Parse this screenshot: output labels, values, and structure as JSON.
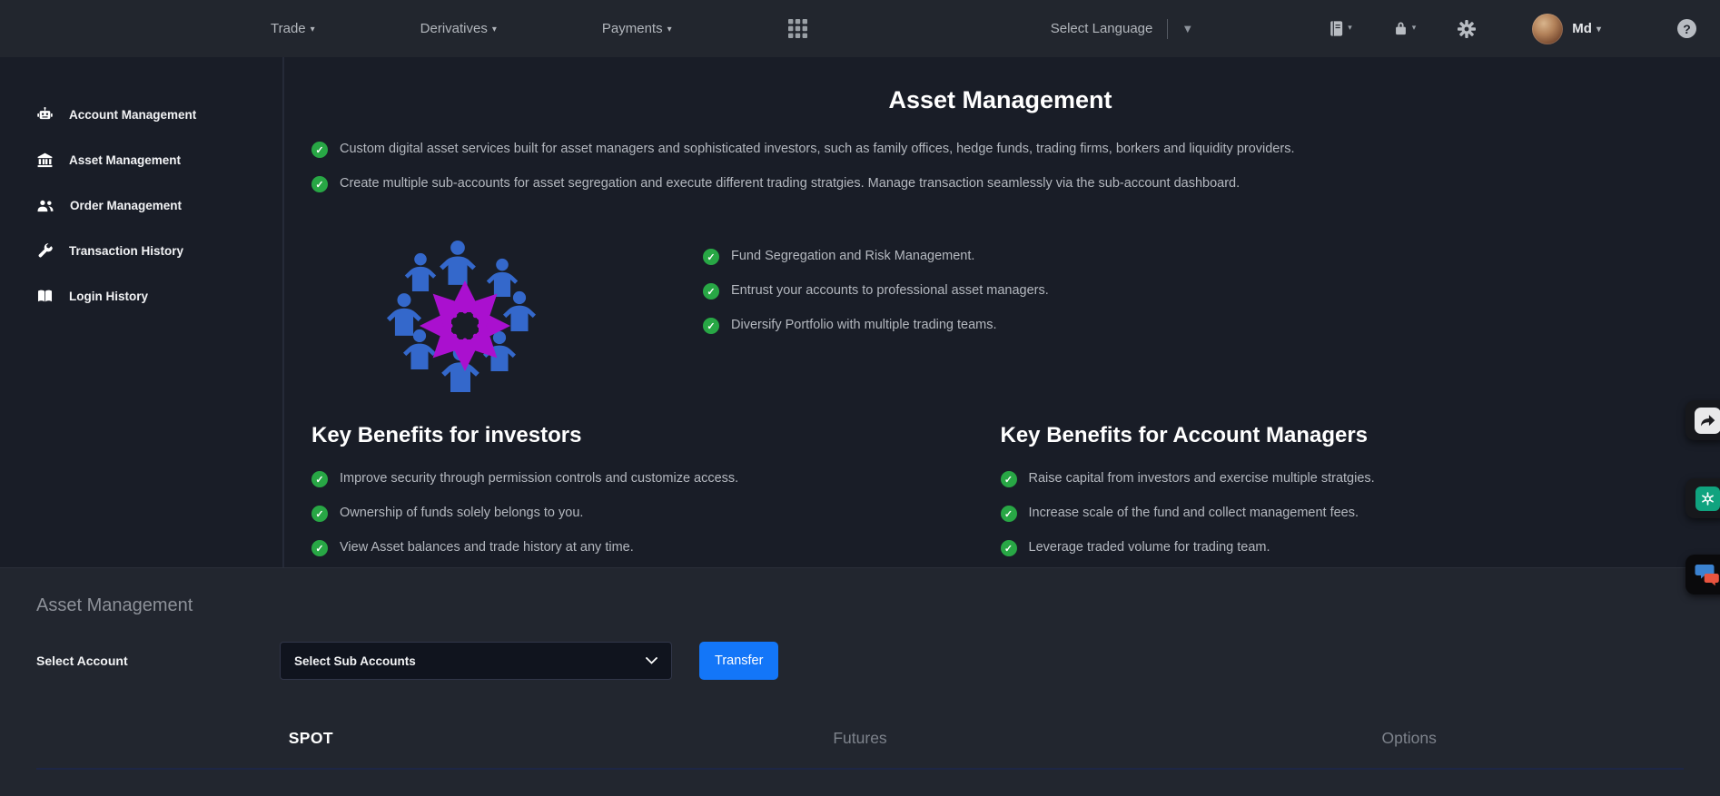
{
  "navbar": {
    "menus": [
      {
        "label": "Trade"
      },
      {
        "label": "Derivatives"
      },
      {
        "label": "Payments"
      }
    ],
    "apps_icon": "grid-icon",
    "language": {
      "label": "Select Language"
    },
    "action_icons": [
      "journal-icon",
      "lock-icon",
      "gear-icon"
    ],
    "user": {
      "name": "Md"
    },
    "help_icon": "question-icon"
  },
  "sidebar": {
    "items": [
      {
        "label": "Account Management",
        "icon": "robot-icon"
      },
      {
        "label": "Asset Management",
        "icon": "bank-icon"
      },
      {
        "label": "Order Management",
        "icon": "users-icon"
      },
      {
        "label": "Transaction History",
        "icon": "wrench-icon"
      },
      {
        "label": "Login History",
        "icon": "book-icon"
      }
    ]
  },
  "main": {
    "title": "Asset Management",
    "intro": [
      "Custom digital asset services built for asset managers and sophisticated investors, such as family offices, hedge funds, trading firms, borkers and liquidity providers.",
      "Create multiple sub-accounts for asset segregation and execute different trading stratgies. Manage transaction seamlessly via the sub-account dashboard."
    ],
    "features": [
      "Fund Segregation and Risk Management.",
      "Entrust your accounts to professional asset managers.",
      "Diversify Portfolio with multiple trading teams."
    ],
    "investors": {
      "heading": "Key Benefits for investors",
      "items": [
        "Improve security through permission controls and customize access.",
        "Ownership of funds solely belongs to you.",
        "View Asset balances and trade history at any time."
      ]
    },
    "managers": {
      "heading": "Key Benefits for Account Managers",
      "items": [
        "Raise capital from investors and exercise multiple stratgies.",
        "Increase scale of the fund and collect management fees.",
        "Leverage traded volume for trading team."
      ]
    }
  },
  "panel": {
    "heading": "Asset Management",
    "select_account_label": "Select Account",
    "sub_accounts_value": "Select Sub Accounts",
    "transfer_label": "Transfer",
    "tabs": [
      {
        "label": "SPOT",
        "active": true
      },
      {
        "label": "Futures",
        "active": false
      },
      {
        "label": "Options",
        "active": false
      }
    ]
  },
  "floating_widgets": [
    "share-icon",
    "chatgpt-icon",
    "chat-bubbles-icon"
  ],
  "colors": {
    "navbar_bg": "#22262e",
    "page_bg": "#191d27",
    "panel_bg": "#22262f",
    "accent_blue": "#1376f8",
    "success_green": "#28a745",
    "illustration_person": "#3468cb",
    "illustration_arrows": "#aa10cf",
    "tab_divider": "#1d2646"
  }
}
